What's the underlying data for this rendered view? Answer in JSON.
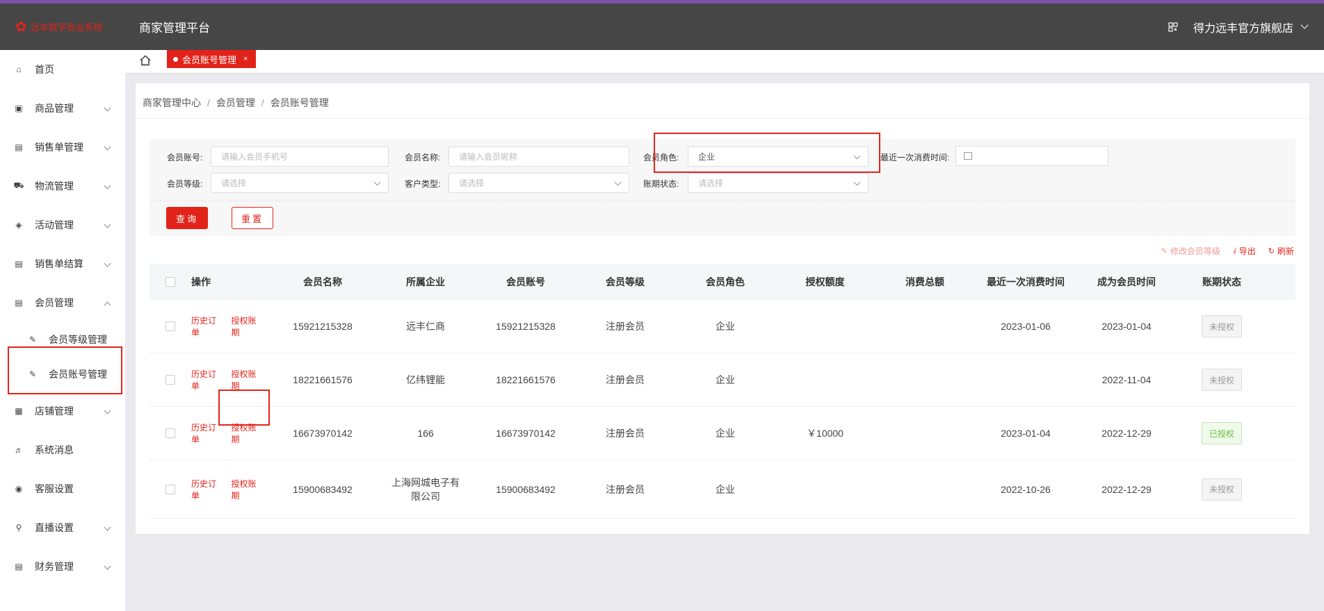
{
  "header": {
    "logo_text": "远丰数字商业系统",
    "platform_title": "商家管理平台",
    "store_name": "得力远丰官方旗舰店"
  },
  "sidebar": {
    "items": [
      {
        "label": "首页",
        "icon": "home-icon",
        "has_arrow": false
      },
      {
        "label": "商品管理",
        "icon": "product-icon",
        "has_arrow": true
      },
      {
        "label": "销售单管理",
        "icon": "sales-order-icon",
        "has_arrow": true
      },
      {
        "label": "物流管理",
        "icon": "truck-icon",
        "has_arrow": true
      },
      {
        "label": "活动管理",
        "icon": "tag-icon",
        "has_arrow": true
      },
      {
        "label": "销售单结算",
        "icon": "settlement-icon",
        "has_arrow": true
      },
      {
        "label": "会员管理",
        "icon": "member-icon",
        "has_arrow": true,
        "expanded": true
      },
      {
        "label": "店铺管理",
        "icon": "store-icon",
        "has_arrow": true
      },
      {
        "label": "系统消息",
        "icon": "speaker-icon",
        "has_arrow": false
      },
      {
        "label": "客服设置",
        "icon": "service-icon",
        "has_arrow": false
      },
      {
        "label": "直播设置",
        "icon": "live-icon",
        "has_arrow": true
      },
      {
        "label": "财务管理",
        "icon": "finance-icon",
        "has_arrow": true
      }
    ],
    "sub_items": [
      {
        "label": "会员等级管理",
        "icon": "edit-icon"
      },
      {
        "label": "会员账号管理",
        "icon": "edit-icon"
      }
    ]
  },
  "tabs": {
    "active_label": "会员账号管理",
    "close_glyph": "×"
  },
  "breadcrumb": [
    "商家管理中心",
    "会员管理",
    "会员账号管理"
  ],
  "breadcrumb_sep": "/",
  "filters": {
    "account_label": "会员账号:",
    "account_placeholder": "请输入会员手机号",
    "name_label": "会员名称:",
    "name_placeholder": "请输入会员昵称",
    "role_label": "会员角色:",
    "role_value": "企业",
    "last_time_label": "最近一次消费时间:",
    "level_label": "会员等级:",
    "level_placeholder": "请选择",
    "customer_type_label": "客户类型:",
    "customer_type_placeholder": "请选择",
    "term_status_label": "账期状态:",
    "term_status_placeholder": "请选择",
    "query_label": "查询",
    "reset_label": "重置"
  },
  "table_actions": {
    "modify_level": "修改会员等级",
    "export": "导出",
    "refresh": "刷新"
  },
  "table": {
    "columns": [
      "操作",
      "会员名称",
      "所属企业",
      "会员账号",
      "会员等级",
      "会员角色",
      "授权额度",
      "消费总额",
      "最近一次消费时间",
      "成为会员时间",
      "账期状态"
    ],
    "op_history": "历史订单",
    "op_authorize": "授权账期",
    "rows": [
      {
        "name": "15921215328",
        "enterprise": "远丰仁商",
        "account": "15921215328",
        "level": "注册会员",
        "role": "企业",
        "credit": "",
        "total": "",
        "last": "2023-01-06",
        "since": "2023-01-04",
        "status": "未授权"
      },
      {
        "name": "18221661576",
        "enterprise": "亿纬锂能",
        "account": "18221661576",
        "level": "注册会员",
        "role": "企业",
        "credit": "",
        "total": "",
        "last": "",
        "since": "2022-11-04",
        "status": "未授权"
      },
      {
        "name": "16673970142",
        "enterprise": "166",
        "account": "16673970142",
        "level": "注册会员",
        "role": "企业",
        "credit": "￥10000",
        "total": "",
        "last": "2023-01-04",
        "since": "2022-12-29",
        "status": "已授权"
      },
      {
        "name": "15900683492",
        "enterprise": "上海网城电子有限公司",
        "account": "15900683492",
        "level": "注册会员",
        "role": "企业",
        "credit": "",
        "total": "",
        "last": "2022-10-26",
        "since": "2022-12-29",
        "status": "未授权"
      }
    ]
  },
  "colors": {
    "accent": "#e2231a",
    "header_bg": "#464646",
    "top_line": "#7b52ab",
    "authorized_green": "#67c23a"
  }
}
